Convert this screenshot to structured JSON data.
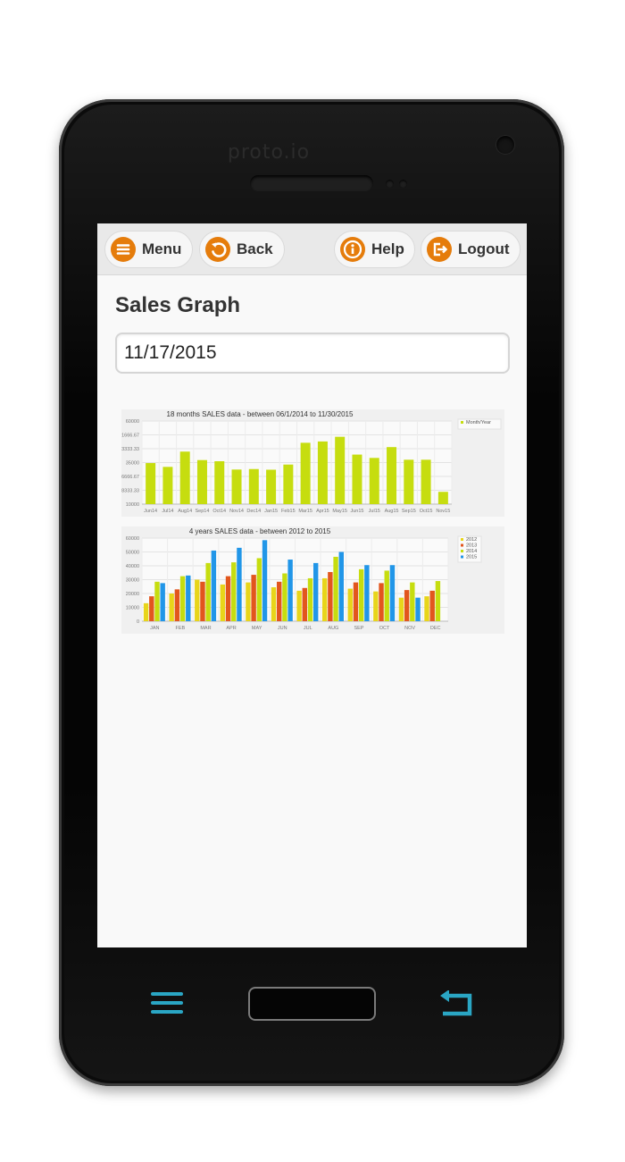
{
  "device": {
    "brand": "proto.io"
  },
  "colors": {
    "accent": "#e57c0b",
    "sys_icon": "#2aa6c4",
    "c2012": "#e8d51a",
    "c2013": "#e2561d",
    "c2014": "#c6dd0f",
    "c2015": "#2196e8",
    "monthly": "#c6dd0f"
  },
  "toolbar": {
    "menu_label": "Menu",
    "back_label": "Back",
    "help_label": "Help",
    "logout_label": "Logout"
  },
  "page": {
    "title": "Sales Graph",
    "date_value": "11/17/2015"
  },
  "chart_data": [
    {
      "type": "bar",
      "title": "18 months SALES data - between 06/1/2014 to 11/30/2015",
      "categories": [
        "Jun14",
        "Jul14",
        "Aug14",
        "Sep14",
        "Oct14",
        "Nov14",
        "Dec14",
        "Jan15",
        "Feb15",
        "Mar15",
        "Apr15",
        "May15",
        "Jun15",
        "Jul15",
        "Aug15",
        "Sep15",
        "Oct15",
        "Nov15"
      ],
      "series": [
        {
          "name": "Month/Year",
          "values": [
            34700,
            32400,
            41600,
            36500,
            35800,
            30800,
            31100,
            30700,
            33800,
            46900,
            47700,
            50500,
            39800,
            37800,
            44300,
            36700,
            36700,
            17400
          ]
        }
      ],
      "ylim": [
        10000,
        60000
      ],
      "yticks": [
        "10000",
        "18333.33",
        "26666.67",
        "35000",
        "43333.33",
        "51666.67",
        "60000"
      ],
      "legend": "top-right",
      "grid": true
    },
    {
      "type": "bar",
      "title": "4 years SALES data - between 2012 to 2015",
      "categories": [
        "JAN",
        "FEB",
        "MAR",
        "APR",
        "MAY",
        "JUN",
        "JUL",
        "AUG",
        "SEP",
        "OCT",
        "NOV",
        "DEC"
      ],
      "series": [
        {
          "name": "2012",
          "values": [
            13000,
            20000,
            30000,
            26500,
            28000,
            24500,
            22000,
            31000,
            23500,
            21500,
            17000,
            18000
          ]
        },
        {
          "name": "2013",
          "values": [
            18000,
            23000,
            28500,
            32500,
            33500,
            28500,
            24000,
            35500,
            28000,
            27500,
            22500,
            22000
          ]
        },
        {
          "name": "2014",
          "values": [
            28500,
            32500,
            42000,
            42500,
            45500,
            34500,
            31000,
            46500,
            37500,
            36500,
            28000,
            29000
          ]
        },
        {
          "name": "2015",
          "values": [
            27500,
            33000,
            51000,
            53000,
            58500,
            44500,
            42000,
            50000,
            40500,
            40500,
            17000,
            0
          ]
        }
      ],
      "ylim": [
        0,
        60000
      ],
      "yticks": [
        "0",
        "10000",
        "20000",
        "30000",
        "40000",
        "50000",
        "60000"
      ],
      "legend": "top-right",
      "grid": true
    }
  ]
}
